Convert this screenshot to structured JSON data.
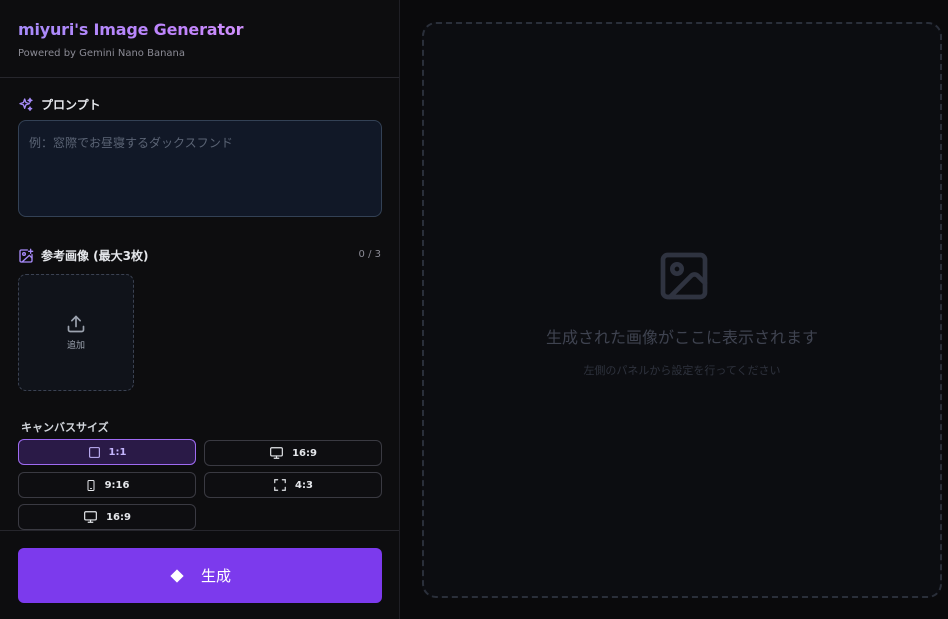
{
  "app": {
    "title": "miyuri's Image Generator",
    "subtitle": "Powered by Gemini Nano Banana"
  },
  "prompt": {
    "label": "プロンプト",
    "placeholder": "例：窓際でお昼寝するダックスフンド",
    "value": ""
  },
  "reference": {
    "label": "参考画像 (最大3枚)",
    "count": "0 / 3",
    "add_label": "追加"
  },
  "canvas": {
    "label": "キャンバスサイズ",
    "options": [
      {
        "label": "1:1",
        "icon": "square-icon",
        "selected": true
      },
      {
        "label": "16:9",
        "icon": "monitor-icon",
        "selected": false
      },
      {
        "label": "9:16",
        "icon": "phone-icon",
        "selected": false
      },
      {
        "label": "4:3",
        "icon": "frame-corners-icon",
        "selected": false
      },
      {
        "label": "16:9",
        "icon": "monitor-icon",
        "selected": false
      }
    ]
  },
  "generate": {
    "label": "生成",
    "icon": "diamond-icon"
  },
  "preview": {
    "title": "生成された画像がここに表示されます",
    "subtitle": "左側のパネルから設定を行ってください",
    "icon": "image-icon"
  },
  "colors": {
    "accent": "#7c3aed",
    "accent_light": "#a78bfa",
    "selected_bg": "#2a1a47"
  }
}
